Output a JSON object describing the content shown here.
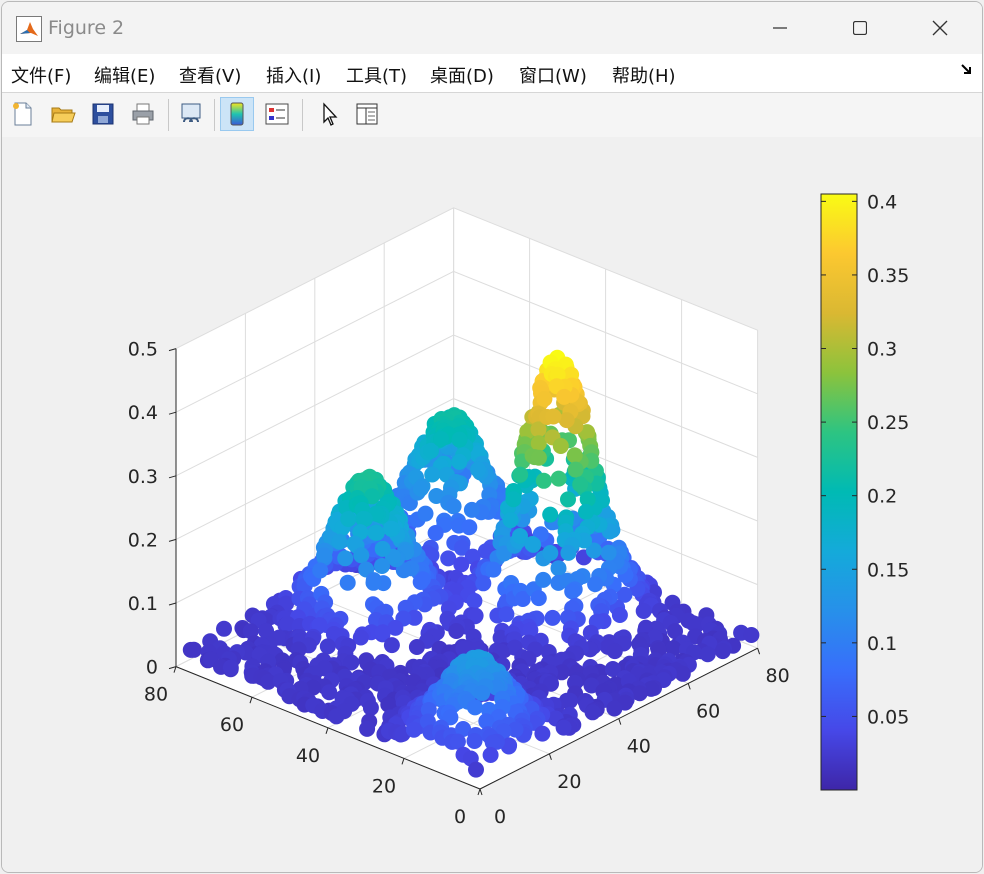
{
  "window": {
    "title": "Figure 2",
    "controls": [
      "minimize",
      "maximize",
      "close"
    ]
  },
  "menubar": {
    "items": [
      {
        "label": "文件(F)"
      },
      {
        "label": "编辑(E)"
      },
      {
        "label": "查看(V)"
      },
      {
        "label": "插入(I)"
      },
      {
        "label": "工具(T)"
      },
      {
        "label": "桌面(D)"
      },
      {
        "label": "窗口(W)"
      },
      {
        "label": "帮助(H)"
      }
    ],
    "dock_icon": "dock-arrow-icon"
  },
  "toolbar": {
    "buttons": [
      {
        "name": "new-figure",
        "icon": "new-file-icon"
      },
      {
        "name": "open-file",
        "icon": "folder-open-icon"
      },
      {
        "name": "save-figure",
        "icon": "save-icon"
      },
      {
        "name": "print-figure",
        "icon": "printer-icon"
      },
      {
        "name": "link-plot",
        "icon": "link-plot-icon"
      },
      {
        "name": "insert-colorbar",
        "icon": "colorbar-icon",
        "active": true
      },
      {
        "name": "insert-legend",
        "icon": "legend-icon"
      },
      {
        "name": "edit-plot",
        "icon": "pointer-arrow-icon"
      },
      {
        "name": "property-inspector",
        "icon": "panel-icon"
      }
    ]
  },
  "chart_data": {
    "type": "scatter",
    "projection": "3d",
    "title": "",
    "xlabel": "",
    "ylabel": "",
    "zlabel": "",
    "xlim": [
      0,
      80
    ],
    "ylim": [
      0,
      80
    ],
    "zlim": [
      0,
      0.5
    ],
    "xticks": [
      0,
      20,
      40,
      60,
      80
    ],
    "yticks": [
      0,
      20,
      40,
      60,
      80
    ],
    "zticks": [
      0,
      0.1,
      0.2,
      0.3,
      0.4,
      0.5
    ],
    "xtick_labels": [
      "0",
      "20",
      "40",
      "60",
      "80"
    ],
    "ytick_labels": [
      "0",
      "20",
      "40",
      "60",
      "80"
    ],
    "ztick_labels": [
      "0",
      "0.1",
      "0.2",
      "0.3",
      "0.4",
      "0.5"
    ],
    "grid": true,
    "colormap": "parula",
    "colorbar": {
      "location": "right",
      "range": [
        0.0,
        0.405
      ],
      "ticks": [
        0.05,
        0.1,
        0.15,
        0.2,
        0.25,
        0.3,
        0.35,
        0.4
      ],
      "tick_labels": [
        "0.05",
        "0.1",
        "0.15",
        "0.2",
        "0.25",
        "0.3",
        "0.35",
        "0.4"
      ]
    },
    "peaks": [
      {
        "x": 64,
        "y": 38,
        "peak_z": 0.405,
        "spread": 7
      },
      {
        "x": 38,
        "y": 64,
        "peak_z": 0.23,
        "spread": 7
      },
      {
        "x": 70,
        "y": 72,
        "peak_z": 0.22,
        "spread": 7
      },
      {
        "x": 12,
        "y": 12,
        "peak_z": 0.14,
        "spread": 7
      }
    ],
    "base_z": 0.02,
    "point_count": 1600
  }
}
